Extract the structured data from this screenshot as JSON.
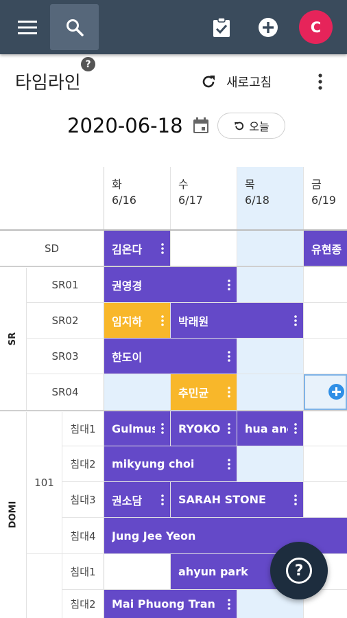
{
  "header": {
    "title": "타임라인",
    "refresh_label": "새로고침",
    "date": "2020-06-18",
    "today_label": "오늘"
  },
  "avatar_initial": "C",
  "days": [
    {
      "dow": "화",
      "date": "6/16"
    },
    {
      "dow": "수",
      "date": "6/17"
    },
    {
      "dow": "목",
      "date": "6/18"
    },
    {
      "dow": "금",
      "date": "6/19"
    }
  ],
  "groups": {
    "sr": "SR",
    "domi": "DOMI"
  },
  "rows": {
    "sd": "SD",
    "sr01": "SR01",
    "sr02": "SR02",
    "sr03": "SR03",
    "sr04": "SR04",
    "room101": "101",
    "bed1": "침대1",
    "bed2": "침대2",
    "bed3": "침대3",
    "bed4": "침대4",
    "bed1b": "침대1",
    "bed2b": "침대2"
  },
  "events": {
    "e1": "김온다",
    "e2": "유현종",
    "e3": "권영경",
    "e4": "임지하",
    "e5": "박래원",
    "e6": "한도이",
    "e7": "추민균",
    "e8": "Gulmus",
    "e9": "RYOKO ...",
    "e10": "hua ang",
    "e11": "mikyung choi",
    "e12": "권소담",
    "e13": "SARAH STONE",
    "e14": "Jung Jee Yeon",
    "e15": "ahyun park",
    "e16": "Mai Phuong Tran"
  },
  "colors": {
    "topbar": "#3a4b5c",
    "event": "#6449c8",
    "event_alt": "#f8b72a",
    "today": "#e3f0fc",
    "avatar": "#e6245a"
  }
}
